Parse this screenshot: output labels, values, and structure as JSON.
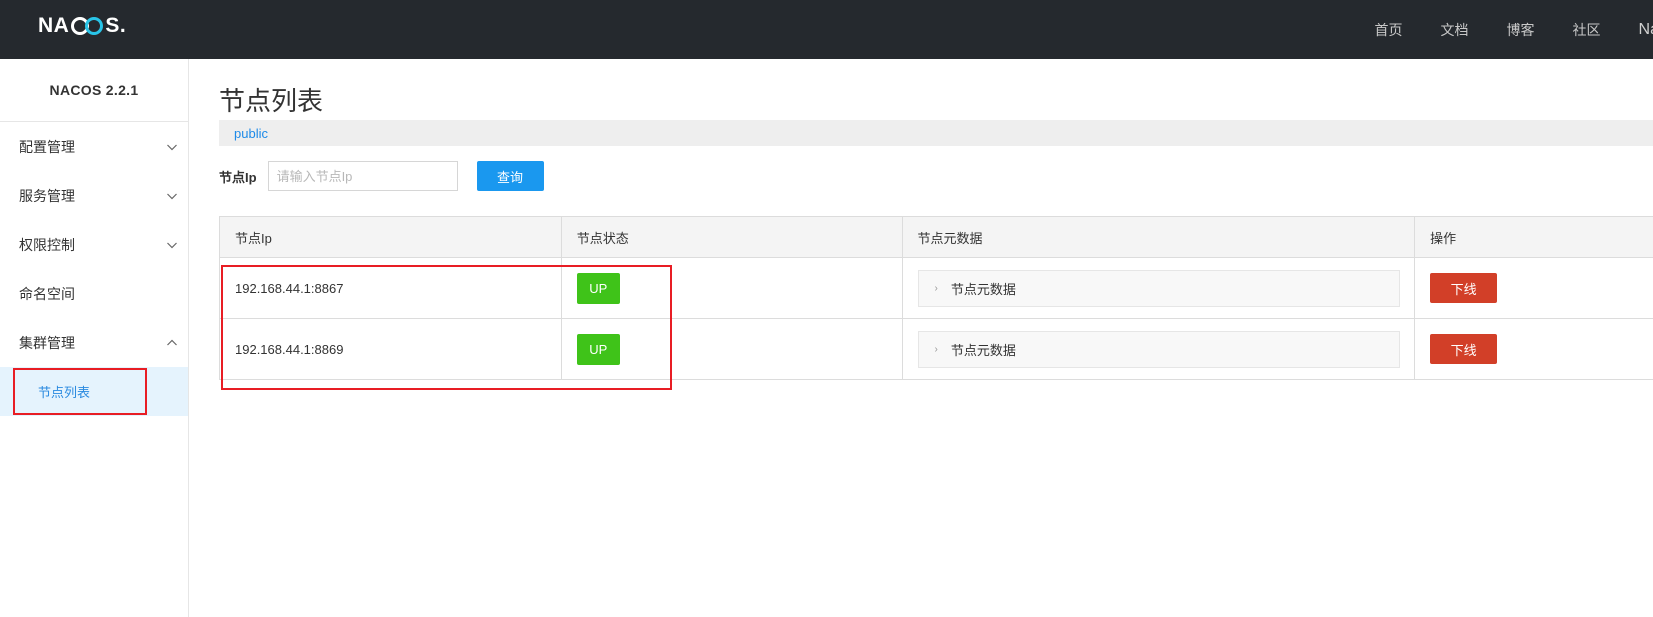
{
  "header": {
    "logo_text_a": "NA",
    "logo_text_b": "C",
    "logo_text_c": "O",
    "logo_text_d": "S",
    "logo_dot": ".",
    "nav": [
      "首页",
      "文档",
      "博客",
      "社区",
      "Na"
    ]
  },
  "sidebar": {
    "version": "NACOS 2.2.1",
    "items": [
      {
        "label": "配置管理",
        "expandable": true
      },
      {
        "label": "服务管理",
        "expandable": true
      },
      {
        "label": "权限控制",
        "expandable": true
      },
      {
        "label": "命名空间",
        "expandable": false
      },
      {
        "label": "集群管理",
        "expandable": true
      }
    ],
    "sub_item": "节点列表"
  },
  "main": {
    "title": "节点列表",
    "namespace": "public",
    "search": {
      "label": "节点Ip",
      "placeholder": "请输入节点Ip",
      "value": "",
      "button": "查询"
    },
    "table": {
      "headers": [
        "节点Ip",
        "节点状态",
        "节点元数据",
        "操作"
      ],
      "rows": [
        {
          "ip": "192.168.44.1:8867",
          "status": "UP",
          "metadata": "节点元数据",
          "action": "下线"
        },
        {
          "ip": "192.168.44.1:8869",
          "status": "UP",
          "metadata": "节点元数据",
          "action": "下线"
        }
      ]
    }
  },
  "colors": {
    "topbar": "#25292e",
    "accent_blue": "#1a98ef",
    "status_up": "#3fc319",
    "danger": "#d23f28",
    "highlight_box": "#e81d24"
  }
}
